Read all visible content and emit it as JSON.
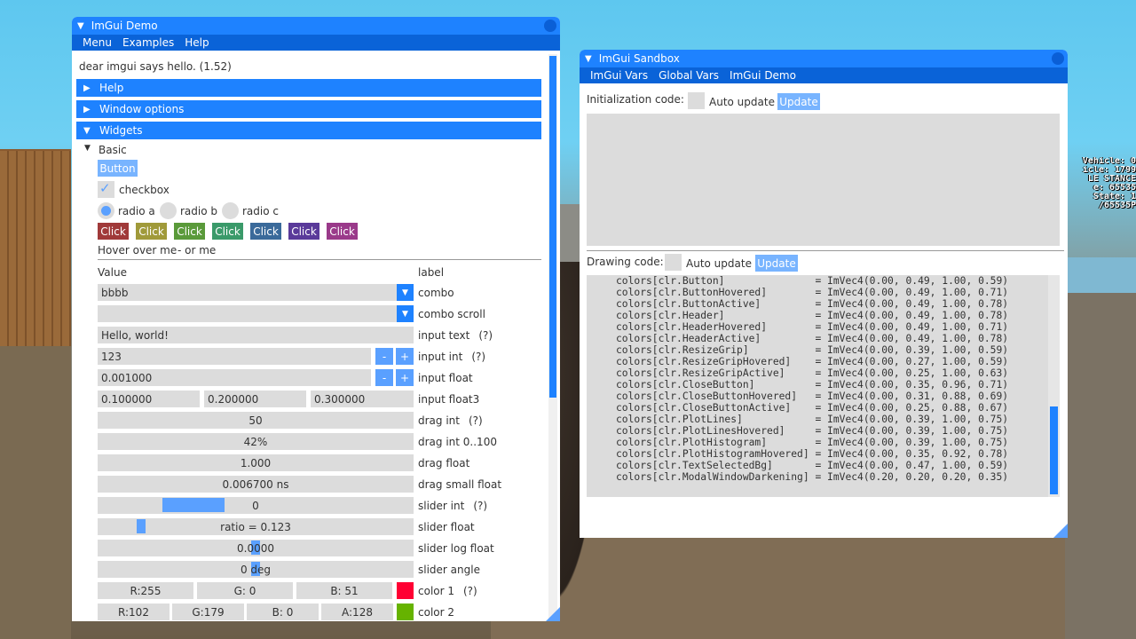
{
  "hud": [
    "Vehicle: 0",
    "icle: 1799",
    "LE STANCE",
    "e: 65535",
    "State: 1",
    "/65535P"
  ],
  "demo": {
    "title": "ImGui Demo",
    "menu": [
      "Menu",
      "Examples",
      "Help"
    ],
    "hello": "dear imgui says hello. (1.52)",
    "headers": {
      "help": "Help",
      "window_options": "Window options",
      "widgets": "Widgets"
    },
    "basic": "Basic",
    "button": "Button",
    "checkbox": "checkbox",
    "radios": [
      "radio a",
      "radio b",
      "radio c"
    ],
    "click_buttons": [
      {
        "label": "Click",
        "color": "#a03a3a"
      },
      {
        "label": "Click",
        "color": "#a09a3a"
      },
      {
        "label": "Click",
        "color": "#5a9a3a"
      },
      {
        "label": "Click",
        "color": "#3a9a6a"
      },
      {
        "label": "Click",
        "color": "#3a6a9a"
      },
      {
        "label": "Click",
        "color": "#5a3a9a"
      },
      {
        "label": "Click",
        "color": "#9a3a8a"
      }
    ],
    "hover": "Hover over me",
    "hover2": "- or me",
    "col_value": "Value",
    "col_label": "label",
    "help_marker": "(?)",
    "combo": {
      "value": "bbbb",
      "label": "combo"
    },
    "combo_scroll": {
      "value": "",
      "label": "combo scroll"
    },
    "input_text": {
      "value": "Hello, world!",
      "label": "input text"
    },
    "input_int": {
      "value": "123",
      "label": "input int"
    },
    "input_float": {
      "value": "0.001000",
      "label": "input float"
    },
    "input_float3": {
      "values": [
        "0.100000",
        "0.200000",
        "0.300000"
      ],
      "label": "input float3"
    },
    "drag_int": {
      "value": "50",
      "label": "drag int"
    },
    "drag_int_range": {
      "value": "42%",
      "label": "drag int 0..100"
    },
    "drag_float": {
      "value": "1.000",
      "label": "drag float"
    },
    "drag_small_float": {
      "value": "0.006700 ns",
      "label": "drag small float"
    },
    "slider_int": {
      "value": "0",
      "label": "slider int",
      "level": 0.5
    },
    "slider_float": {
      "value": "ratio = 0.123",
      "label": "slider float",
      "level": 0.123
    },
    "slider_log_float": {
      "value": "0.0000",
      "label": "slider log float"
    },
    "slider_angle": {
      "value": "0 deg",
      "label": "slider angle"
    },
    "color1": {
      "r": "R:255",
      "g": "G:  0",
      "b": "B: 51",
      "label": "color 1",
      "swatch": "#ff0033"
    },
    "color2": {
      "r": "R:102",
      "g": "G:179",
      "b": "B:  0",
      "a": "A:128",
      "label": "color 2",
      "swatch": "#66b300"
    },
    "minus": "-",
    "plus": "+"
  },
  "sandbox": {
    "title": "ImGui Sandbox",
    "menu": [
      "ImGui Vars",
      "Global Vars",
      "ImGui Demo"
    ],
    "init_label": "Initialization code:",
    "auto_update": "Auto update",
    "update": "Update",
    "draw_label": "Drawing code:",
    "code_lines": [
      "colors[clr.Button]               = ImVec4(0.00, 0.49, 1.00, 0.59)",
      "colors[clr.ButtonHovered]        = ImVec4(0.00, 0.49, 1.00, 0.71)",
      "colors[clr.ButtonActive]         = ImVec4(0.00, 0.49, 1.00, 0.78)",
      "colors[clr.Header]               = ImVec4(0.00, 0.49, 1.00, 0.78)",
      "colors[clr.HeaderHovered]        = ImVec4(0.00, 0.49, 1.00, 0.71)",
      "colors[clr.HeaderActive]         = ImVec4(0.00, 0.49, 1.00, 0.78)",
      "colors[clr.ResizeGrip]           = ImVec4(0.00, 0.39, 1.00, 0.59)",
      "colors[clr.ResizeGripHovered]    = ImVec4(0.00, 0.27, 1.00, 0.59)",
      "colors[clr.ResizeGripActive]     = ImVec4(0.00, 0.25, 1.00, 0.63)",
      "colors[clr.CloseButton]          = ImVec4(0.00, 0.35, 0.96, 0.71)",
      "colors[clr.CloseButtonHovered]   = ImVec4(0.00, 0.31, 0.88, 0.69)",
      "colors[clr.CloseButtonActive]    = ImVec4(0.00, 0.25, 0.88, 0.67)",
      "colors[clr.PlotLines]            = ImVec4(0.00, 0.39, 1.00, 0.75)",
      "colors[clr.PlotLinesHovered]     = ImVec4(0.00, 0.39, 1.00, 0.75)",
      "colors[clr.PlotHistogram]        = ImVec4(0.00, 0.39, 1.00, 0.75)",
      "colors[clr.PlotHistogramHovered] = ImVec4(0.00, 0.35, 0.92, 0.78)",
      "colors[clr.TextSelectedBg]       = ImVec4(0.00, 0.47, 1.00, 0.59)",
      "colors[clr.ModalWindowDarkening] = ImVec4(0.20, 0.20, 0.20, 0.35)"
    ]
  }
}
